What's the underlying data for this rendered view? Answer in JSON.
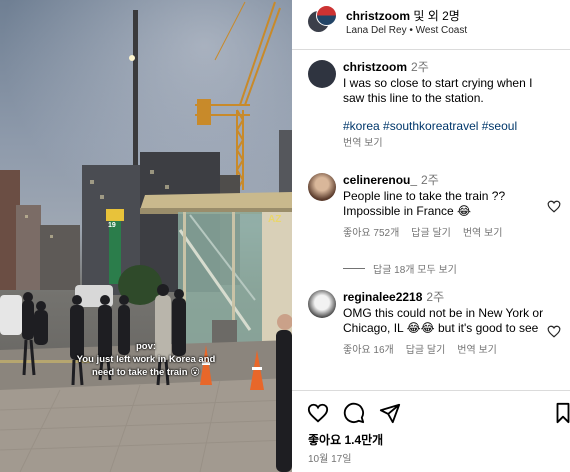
{
  "video": {
    "overlay_line1": "pov:",
    "overlay_line2": "You just left work in Korea and",
    "overlay_line3": "need to take the train 😮",
    "signs": [
      "19",
      "AZ"
    ]
  },
  "header": {
    "username": "christzoom",
    "with_others": "및 외 2명",
    "subtitle": "Lana Del Rey • West Coast"
  },
  "caption": {
    "username": "christzoom",
    "time": "2주",
    "text": "I was so close to start crying when I saw this line to the station.",
    "hashtags": "#korea #southkoreatravel #seoul",
    "translate": "번역 보기"
  },
  "comments": [
    {
      "username": "celinerenou_",
      "time": "2주",
      "text": "People line to take the train ?? Impossible in France 😂",
      "likes": "좋아요 752개",
      "reply": "답글 달기",
      "translate": "번역 보기",
      "view_replies": "답글 18개 모두 보기"
    },
    {
      "username": "reginalee2218",
      "time": "2주",
      "text": "OMG this could not be in New York or Chicago, IL 😂😂 but it's good to see",
      "likes": "좋아요 16개",
      "reply": "답글 달기",
      "translate": "번역 보기"
    }
  ],
  "actions": {
    "icons": [
      "heart-icon",
      "comment-icon",
      "share-icon",
      "save-icon"
    ],
    "likes": "좋아요 1.4만개",
    "date": "10월 17일"
  },
  "colors": {
    "hashtag": "#00376b",
    "muted": "#737373",
    "divider": "#dbdbdb"
  }
}
